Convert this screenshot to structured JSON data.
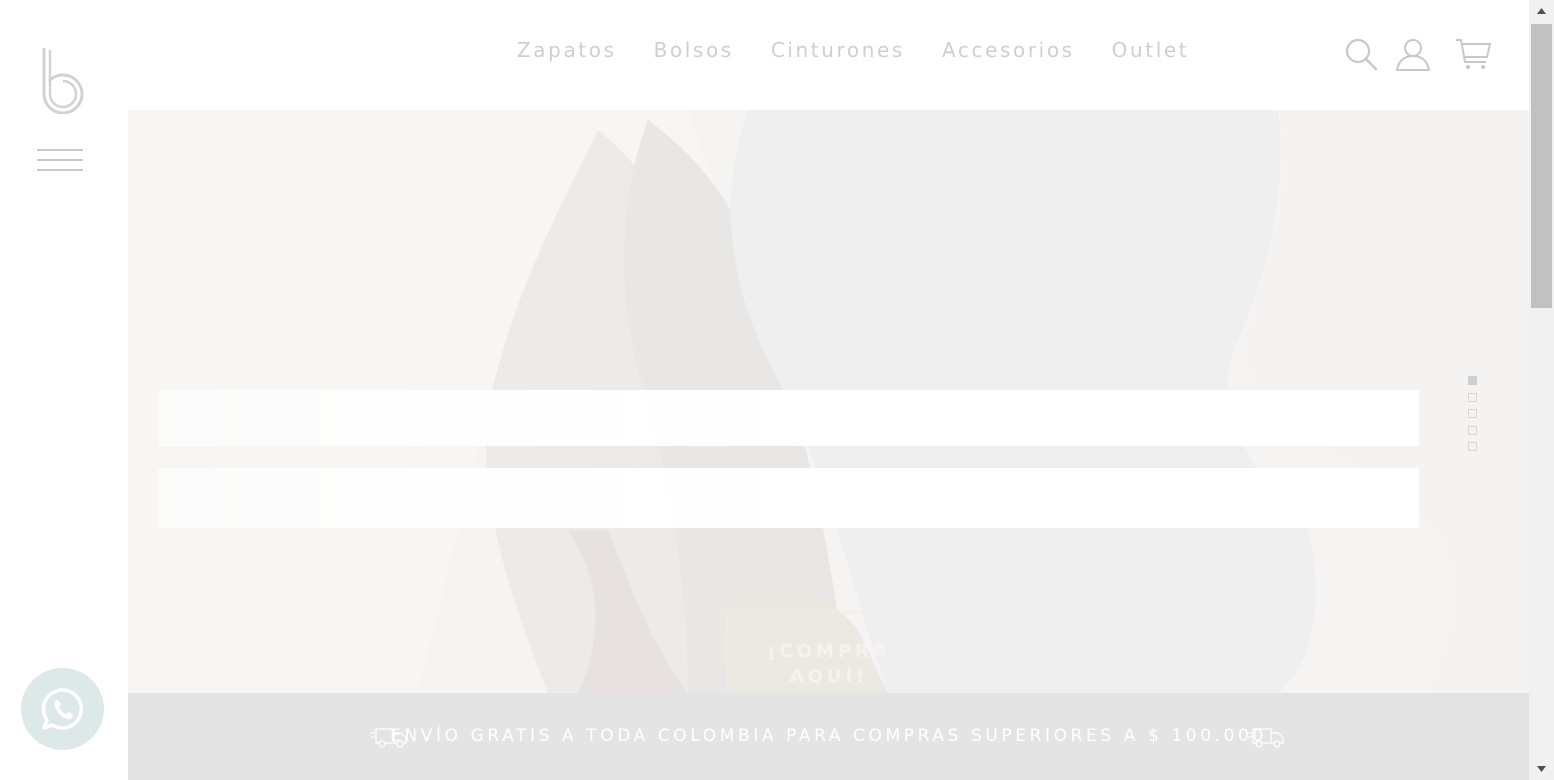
{
  "nav": {
    "items": [
      "Zapatos",
      "Bolsos",
      "Cinturones",
      "Accesorios",
      "Outlet"
    ]
  },
  "header_icons": [
    "search-icon",
    "user-icon",
    "cart-icon"
  ],
  "hero": {
    "cta_line1": "¡COMPRA",
    "cta_line2": "AQUÍ!",
    "slide_count": 5,
    "active_slide": 1
  },
  "shipping_banner": {
    "text": "ENVÍO GRATIS A TODA COLOMBIA PARA COMPRAS SUPERIORES A $ 100.000"
  },
  "colors": {
    "nav_text": "#cfcfcf",
    "banner_bg": "#e4e4e4",
    "whatsapp_bg": "#dde9e9"
  }
}
